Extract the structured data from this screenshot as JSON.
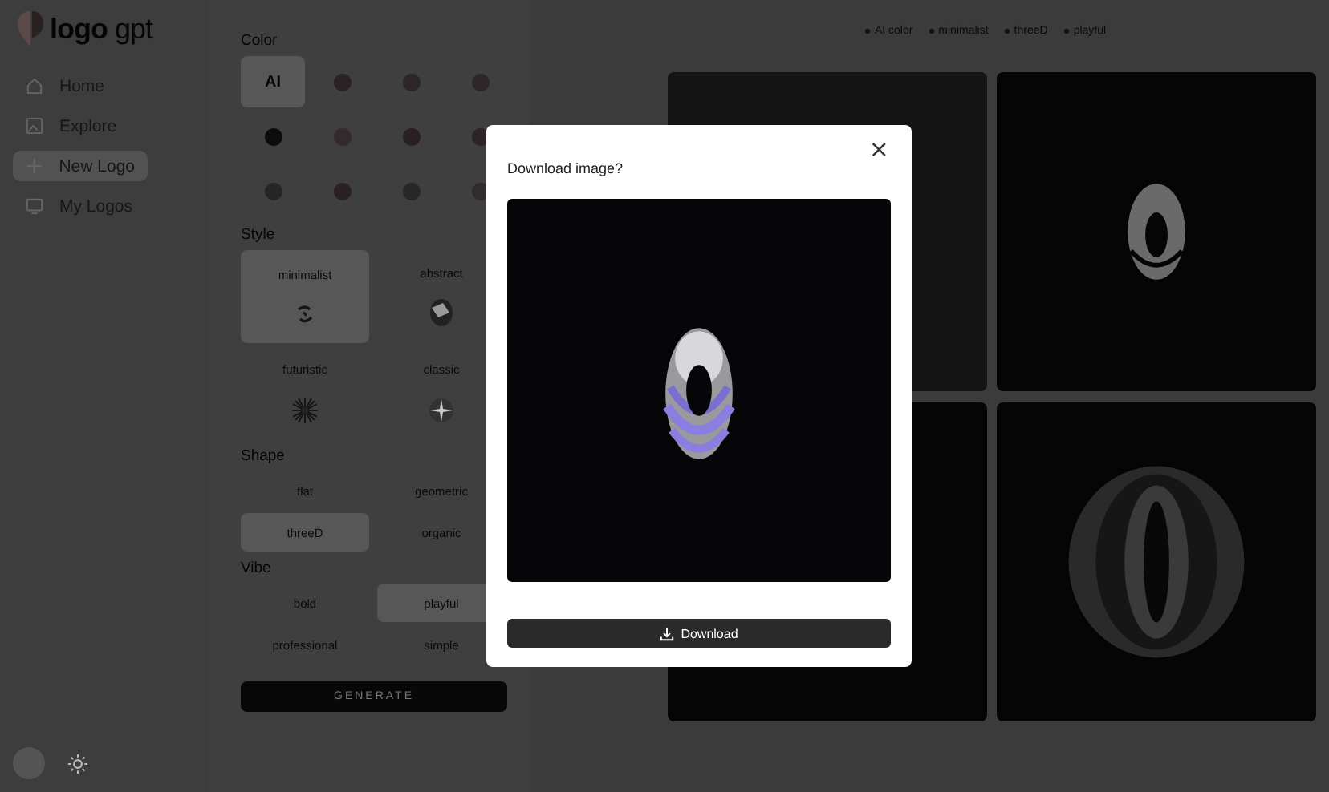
{
  "brand": {
    "name_bold": "logo",
    "name_light": "gpt"
  },
  "nav": [
    {
      "label": "Home",
      "selected": false
    },
    {
      "label": "Explore",
      "selected": false
    },
    {
      "label": "New Logo",
      "selected": true
    },
    {
      "label": "My Logos",
      "selected": false
    }
  ],
  "options": {
    "color_title": "Color",
    "colors": [
      {
        "kind": "ai",
        "label": "AI",
        "selected": true
      },
      {
        "kind": "swatch",
        "color": "#2a2224",
        "selected": false
      },
      {
        "kind": "swatch",
        "color": "#2c2628",
        "selected": false
      },
      {
        "kind": "swatch",
        "color": "#2e2729",
        "selected": false
      },
      {
        "kind": "swatch",
        "color": "#0c0c0c",
        "selected": false
      },
      {
        "kind": "swatch",
        "color": "#322a2c",
        "selected": false
      },
      {
        "kind": "swatch",
        "color": "#2a2022",
        "selected": false
      },
      {
        "kind": "swatch",
        "color": "#2d2426",
        "selected": false
      },
      {
        "kind": "swatch",
        "color": "#262626",
        "selected": false
      },
      {
        "kind": "swatch",
        "color": "#2b2123",
        "selected": false
      },
      {
        "kind": "swatch",
        "color": "#2a2627",
        "selected": false
      },
      {
        "kind": "swatch",
        "color": "#302c2d",
        "selected": false
      }
    ],
    "style_title": "Style",
    "styles": [
      {
        "label": "minimalist",
        "selected": true
      },
      {
        "label": "abstract",
        "selected": false
      },
      {
        "label": "futuristic",
        "selected": false
      },
      {
        "label": "classic",
        "selected": false
      }
    ],
    "shape_title": "Shape",
    "shapes": [
      {
        "label": "flat",
        "selected": false
      },
      {
        "label": "geometric",
        "selected": false
      },
      {
        "label": "threeD",
        "selected": true
      },
      {
        "label": "organic",
        "selected": false
      }
    ],
    "vibe_title": "Vibe",
    "vibes": [
      {
        "label": "bold",
        "selected": false
      },
      {
        "label": "playful",
        "selected": true
      },
      {
        "label": "professional",
        "selected": false
      },
      {
        "label": "simple",
        "selected": false
      }
    ],
    "generate": "GENERATE"
  },
  "tags": [
    "AI color",
    "minimalist",
    "threeD",
    "playful"
  ],
  "modal": {
    "title": "Download image?",
    "close": "×",
    "button": "Download"
  }
}
